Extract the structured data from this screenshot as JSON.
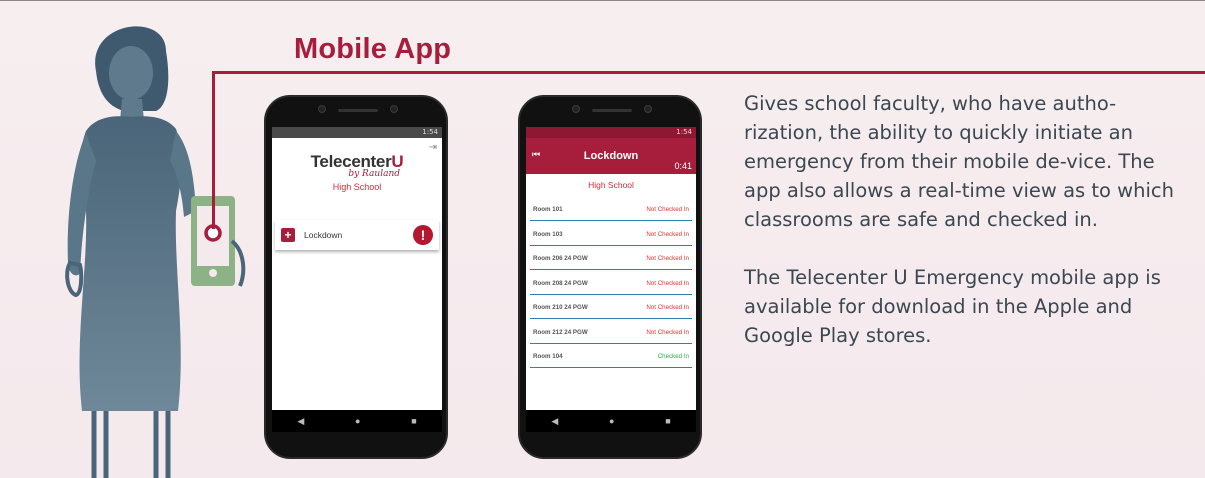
{
  "heading": "Mobile App",
  "description": [
    "Gives school faculty, who have autho-rization, the ability to quickly initiate an emergency from their mobile de-vice. The app also allows a real-time view as to which classrooms are safe and checked in.",
    "The Telecenter U Emergency mobile app is available for download in the Apple and Google Play stores."
  ],
  "phone1": {
    "time": "1:54",
    "logo_main": "Telecenter",
    "logo_u": "U",
    "logo_by": "by Rauland",
    "school": "High School",
    "action_label": "Lockdown",
    "alert_symbol": "!"
  },
  "phone2": {
    "time": "1:54",
    "title": "Lockdown",
    "timer": "0:41",
    "school": "High School",
    "rooms": [
      {
        "name": "Room 101",
        "status": "Not Checked In"
      },
      {
        "name": "Room 103",
        "status": "Not Checked In"
      },
      {
        "name": "Room 206 24 PGW",
        "status": "Not Checked In"
      },
      {
        "name": "Room 208 24 PGW",
        "status": "Not Checked In"
      },
      {
        "name": "Room 210 24 PGW",
        "status": "Not Checked In"
      },
      {
        "name": "Room 212 24 PGW",
        "status": "Not Checked In"
      },
      {
        "name": "Room 104",
        "status": "Checked In"
      }
    ]
  },
  "nav_icons": [
    "back-icon",
    "home-icon",
    "recents-icon"
  ],
  "colors": {
    "accent": "#a71d3c",
    "figure": "#4f6b7e",
    "phone_green": "#8db285",
    "checked_in": "#2aa94a",
    "not_checked": "#e53232"
  }
}
